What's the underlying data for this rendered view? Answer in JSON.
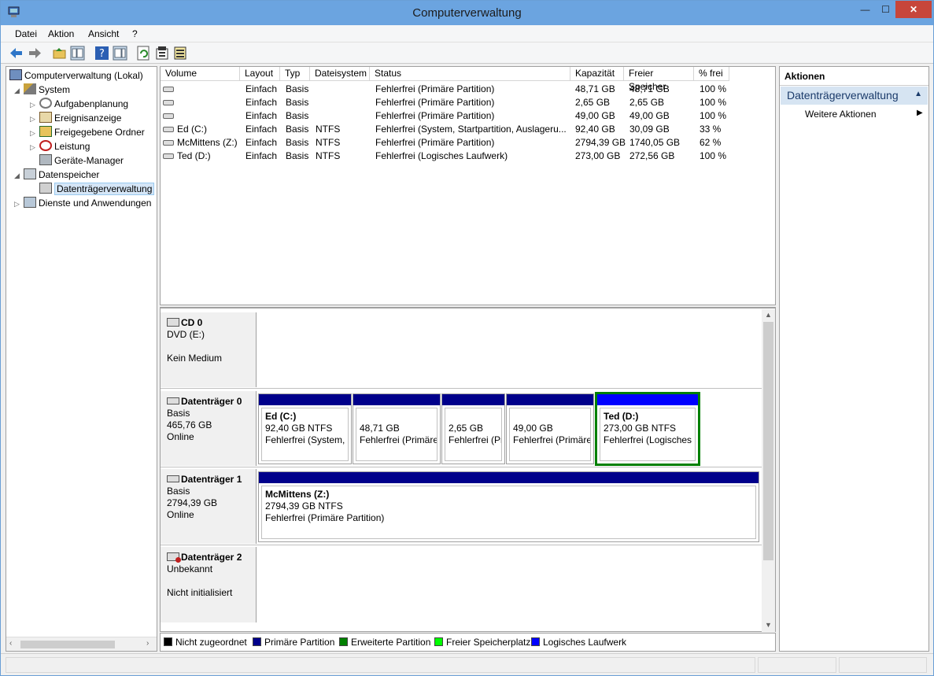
{
  "window": {
    "title": "Computerverwaltung",
    "minimize": "—",
    "maximize": "☐",
    "close": "✕"
  },
  "menu": [
    "Datei",
    "Aktion",
    "Ansicht",
    "?"
  ],
  "tree": {
    "root": "Computerverwaltung (Lokal)",
    "system": "System",
    "aufgaben": "Aufgabenplanung",
    "ereignis": "Ereignisanzeige",
    "freigegeben": "Freigegebene Ordner",
    "leistung": "Leistung",
    "geraete": "Geräte-Manager",
    "datenspeicher": "Datenspeicher",
    "datentraeger": "Datenträgerverwaltung",
    "dienste": "Dienste und Anwendungen"
  },
  "table": {
    "headers": [
      "Volume",
      "Layout",
      "Typ",
      "Dateisystem",
      "Status",
      "Kapazität",
      "Freier Speicher",
      "% frei"
    ],
    "rows": [
      [
        "",
        "Einfach",
        "Basis",
        "",
        "Fehlerfrei (Primäre Partition)",
        "48,71 GB",
        "48,71 GB",
        "100 %"
      ],
      [
        "",
        "Einfach",
        "Basis",
        "",
        "Fehlerfrei (Primäre Partition)",
        "2,65 GB",
        "2,65 GB",
        "100 %"
      ],
      [
        "",
        "Einfach",
        "Basis",
        "",
        "Fehlerfrei (Primäre Partition)",
        "49,00 GB",
        "49,00 GB",
        "100 %"
      ],
      [
        "Ed (C:)",
        "Einfach",
        "Basis",
        "NTFS",
        "Fehlerfrei (System, Startpartition, Auslageru...",
        "92,40 GB",
        "30,09 GB",
        "33 %"
      ],
      [
        "McMittens (Z:)",
        "Einfach",
        "Basis",
        "NTFS",
        "Fehlerfrei (Primäre Partition)",
        "2794,39 GB",
        "1740,05 GB",
        "62 %"
      ],
      [
        "Ted (D:)",
        "Einfach",
        "Basis",
        "NTFS",
        "Fehlerfrei (Logisches Laufwerk)",
        "273,00 GB",
        "272,56 GB",
        "100 %"
      ]
    ]
  },
  "disks": {
    "cd0": {
      "name": "CD 0",
      "l1": "DVD (E:)",
      "l2": "",
      "l3": "Kein Medium"
    },
    "d0": {
      "name": "Datenträger 0",
      "l1": "Basis",
      "l2": "465,76 GB",
      "l3": "Online"
    },
    "d1": {
      "name": "Datenträger 1",
      "l1": "Basis",
      "l2": "2794,39 GB",
      "l3": "Online"
    },
    "d2": {
      "name": "Datenträger 2",
      "l1": "Unbekannt",
      "l2": "",
      "l3": "Nicht initialisiert"
    }
  },
  "partitions": {
    "p0": {
      "name": "Ed  (C:)",
      "size": "92,40 GB NTFS",
      "status": "Fehlerfrei (System, S"
    },
    "p1": {
      "name": "",
      "size": "48,71 GB",
      "status": "Fehlerfrei (Primäre"
    },
    "p2": {
      "name": "",
      "size": "2,65 GB",
      "status": "Fehlerfrei (Pr"
    },
    "p3": {
      "name": "",
      "size": "49,00 GB",
      "status": "Fehlerfrei (Primäre"
    },
    "p4": {
      "name": "Ted  (D:)",
      "size": "273,00 GB NTFS",
      "status": "Fehlerfrei (Logisches"
    },
    "p5": {
      "name": "McMittens  (Z:)",
      "size": "2794,39 GB NTFS",
      "status": "Fehlerfrei (Primäre Partition)"
    }
  },
  "legend": [
    {
      "label": "Nicht zugeordnet",
      "color": "#000000"
    },
    {
      "label": "Primäre Partition",
      "color": "#00008b"
    },
    {
      "label": "Erweiterte Partition",
      "color": "#008000"
    },
    {
      "label": "Freier Speicherplatz",
      "color": "#00ff00"
    },
    {
      "label": "Logisches Laufwerk",
      "color": "#0000ff"
    }
  ],
  "actions": {
    "header": "Aktionen",
    "section": "Datenträgerverwaltung",
    "more": "Weitere Aktionen"
  },
  "colors": {
    "primary": "#00008b",
    "logical": "#0000ff",
    "selected_border": "#008000",
    "titlebar": "#6ba4e0"
  }
}
